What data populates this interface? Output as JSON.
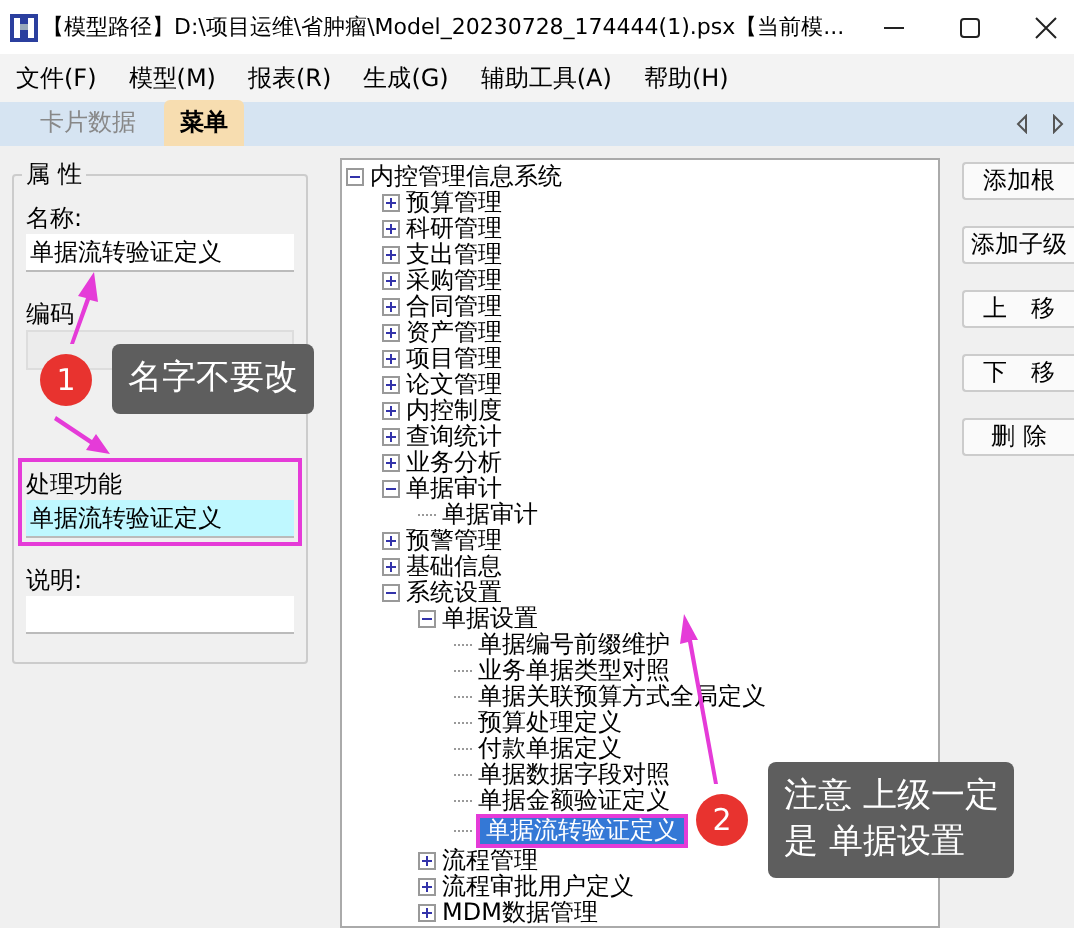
{
  "window": {
    "title": "【模型路径】D:\\项目运维\\省肿瘤\\Model_20230728_174444(1).psx【当前模..."
  },
  "menu": [
    "文件(F)",
    "模型(M)",
    "报表(R)",
    "生成(G)",
    "辅助工具(A)",
    "帮助(H)"
  ],
  "tabs": [
    {
      "label": "卡片数据",
      "selected": false
    },
    {
      "label": "菜单",
      "selected": true
    }
  ],
  "properties": {
    "title": "属 性",
    "fields": [
      {
        "label": "名称:",
        "value": "单据流转验证定义",
        "disabled": false,
        "highlighted": false
      },
      {
        "label": "编码",
        "disabled": true,
        "highlighted": false
      },
      {
        "label": "处理功能",
        "value": "单据流转验证定义",
        "disabled": false,
        "highlighted": true
      },
      {
        "label": "说明:",
        "disabled": false,
        "highlighted": false
      }
    ]
  },
  "tree": [
    {
      "label": "内控管理信息系统",
      "expanded": true,
      "selected": false,
      "children": [
        {
          "label": "预算管理",
          "expanded": false,
          "selected": false
        },
        {
          "label": "科研管理",
          "expanded": false,
          "selected": false
        },
        {
          "label": "支出管理",
          "expanded": false,
          "selected": false
        },
        {
          "label": "采购管理",
          "expanded": false,
          "selected": false
        },
        {
          "label": "合同管理",
          "expanded": false,
          "selected": false
        },
        {
          "label": "资产管理",
          "expanded": false,
          "selected": false
        },
        {
          "label": "项目管理",
          "expanded": false,
          "selected": false
        },
        {
          "label": "论文管理",
          "expanded": false,
          "selected": false
        },
        {
          "label": "内控制度",
          "expanded": false,
          "selected": false
        },
        {
          "label": "查询统计",
          "expanded": false,
          "selected": false
        },
        {
          "label": "业务分析",
          "expanded": false,
          "selected": false
        },
        {
          "label": "单据审计",
          "expanded": true,
          "selected": false,
          "children": [
            {
              "label": "单据审计",
              "selected": false
            }
          ]
        },
        {
          "label": "预警管理",
          "expanded": false,
          "selected": false
        },
        {
          "label": "基础信息",
          "expanded": false,
          "selected": false
        },
        {
          "label": "系统设置",
          "expanded": true,
          "selected": false,
          "children": [
            {
              "label": "单据设置",
              "expanded": true,
              "selected": false,
              "children": [
                {
                  "label": "单据编号前缀维护",
                  "selected": false
                },
                {
                  "label": "业务单据类型对照",
                  "selected": false
                },
                {
                  "label": "单据关联预算方式全局定义",
                  "selected": false
                },
                {
                  "label": "预算处理定义",
                  "selected": false
                },
                {
                  "label": "付款单据定义",
                  "selected": false
                },
                {
                  "label": "单据数据字段对照",
                  "selected": false
                },
                {
                  "label": "单据金额验证定义",
                  "selected": false
                },
                {
                  "label": "单据流转验证定义",
                  "selected": true
                }
              ]
            },
            {
              "label": "流程管理",
              "expanded": false,
              "selected": false
            },
            {
              "label": "流程审批用户定义",
              "expanded": false,
              "selected": false
            },
            {
              "label": "MDM数据管理",
              "expanded": false,
              "selected": false
            }
          ]
        }
      ]
    }
  ],
  "buttons": [
    "添加根",
    "添加子级",
    "上　移",
    "下　移",
    "删 除"
  ],
  "annotations": [
    {
      "number": "1",
      "lines": [
        "名字不要改"
      ]
    },
    {
      "number": "2",
      "lines": [
        "注意 上级一定",
        "是 单据设置"
      ]
    }
  ]
}
